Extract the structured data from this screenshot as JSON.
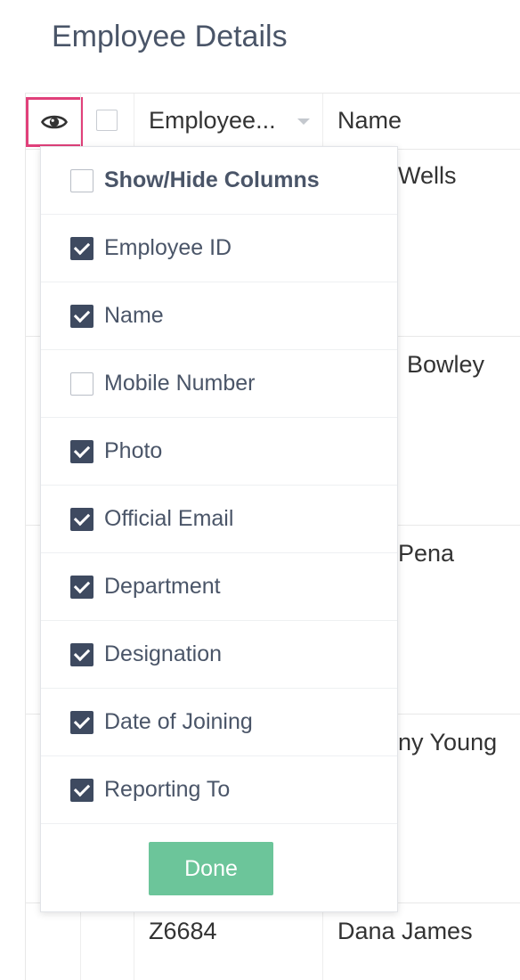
{
  "page": {
    "title": "Employee Details"
  },
  "table": {
    "columns": [
      "Employee...",
      "Name"
    ],
    "rows": [
      {
        "id": "",
        "name": "Wells"
      },
      {
        "id": "",
        "name": "Bowley"
      },
      {
        "id": "",
        "name": "Pena"
      },
      {
        "id": "",
        "name": "ny Young"
      },
      {
        "id": "Z6684",
        "name": "Dana James"
      }
    ]
  },
  "column_picker": {
    "header": {
      "label": "Show/Hide Columns",
      "checked": false
    },
    "items": [
      {
        "label": "Employee ID",
        "checked": true
      },
      {
        "label": "Name",
        "checked": true
      },
      {
        "label": "Mobile Number",
        "checked": false
      },
      {
        "label": "Photo",
        "checked": true
      },
      {
        "label": "Official Email",
        "checked": true
      },
      {
        "label": "Department",
        "checked": true
      },
      {
        "label": "Designation",
        "checked": true
      },
      {
        "label": "Date of Joining",
        "checked": true
      },
      {
        "label": "Reporting To",
        "checked": true
      }
    ],
    "done_label": "Done"
  },
  "colors": {
    "highlight_border": "#e0407a",
    "checkbox_checked": "#3e4a60",
    "done_button": "#6cc59a"
  },
  "icons": {
    "toggle_columns": "eye-icon",
    "sort": "caret-down-icon"
  }
}
